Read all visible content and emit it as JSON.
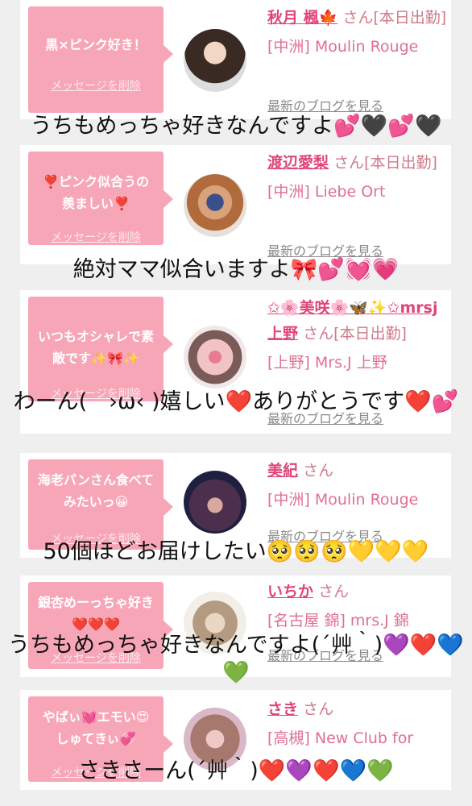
{
  "cards": [
    {
      "message": "黒×ピンク好き！",
      "delete_label": "メッセージを削除",
      "name": "秋月 楓🍁",
      "san": "さん[本日出勤]",
      "shop": "[中洲] Moulin Rouge",
      "blog": "最新のブログを見る",
      "comment": "うちもめっちゃ好きなんですよ💕🖤💕🖤"
    },
    {
      "message": "❣️ピンク似合うの羨ましい❣️",
      "delete_label": "メッセージを削除",
      "name": "渡辺愛梨",
      "san": "さん[本日出勤]",
      "shop": "[中洲] Liebe Ort",
      "blog": "最新のブログを見る",
      "comment": "絶対ママ似合いますよ🎀💕💓💗"
    },
    {
      "message": "いつもオシャレで素敵です✨🎀✨",
      "delete_label": "メッセージを削除",
      "name": "✩🌸美咲🌸🦋✨✩mrsj上野",
      "san": "さん[本日出勤]",
      "shop": "[上野] Mrs.J 上野",
      "blog": "最新のブログを見る",
      "comment": "わーん(　›ω‹ )嬉しい❤️ありがとうです❤️💕"
    },
    {
      "message": "海老パンさん食べてみたいっ😀",
      "delete_label": "メッセージを削除",
      "name": "美紀",
      "san": "さん",
      "shop": "[中洲] Moulin Rouge",
      "blog": "最新のブログを見る",
      "comment": "50個ほどお届けしたい🥺🥺🥺💛💛💛"
    },
    {
      "message": "銀杏めーっちゃ好き❤️❤️❤️",
      "delete_label": "メッセージを削除",
      "name": "いちか",
      "san": "さん",
      "shop": "[名古屋 錦] mrs.J 錦",
      "blog": "最新のブログを見る",
      "comment": "うちもめっちゃ好きなんですよ(´艸｀)💜❤️💙💚"
    },
    {
      "message": "やばぃ💓エモい😍しゅてきぃ💞",
      "delete_label": "メッセージを削除",
      "name": "さき",
      "san": "さん",
      "shop": "[高槻] New Club for",
      "blog": "最新のブログを見る",
      "comment": "さきさーん(´艸｀)❤️💜❤️💙💚"
    }
  ],
  "colors": {
    "bubble": "#f7a6b8",
    "name": "#e0457a",
    "background": "#efefef"
  }
}
